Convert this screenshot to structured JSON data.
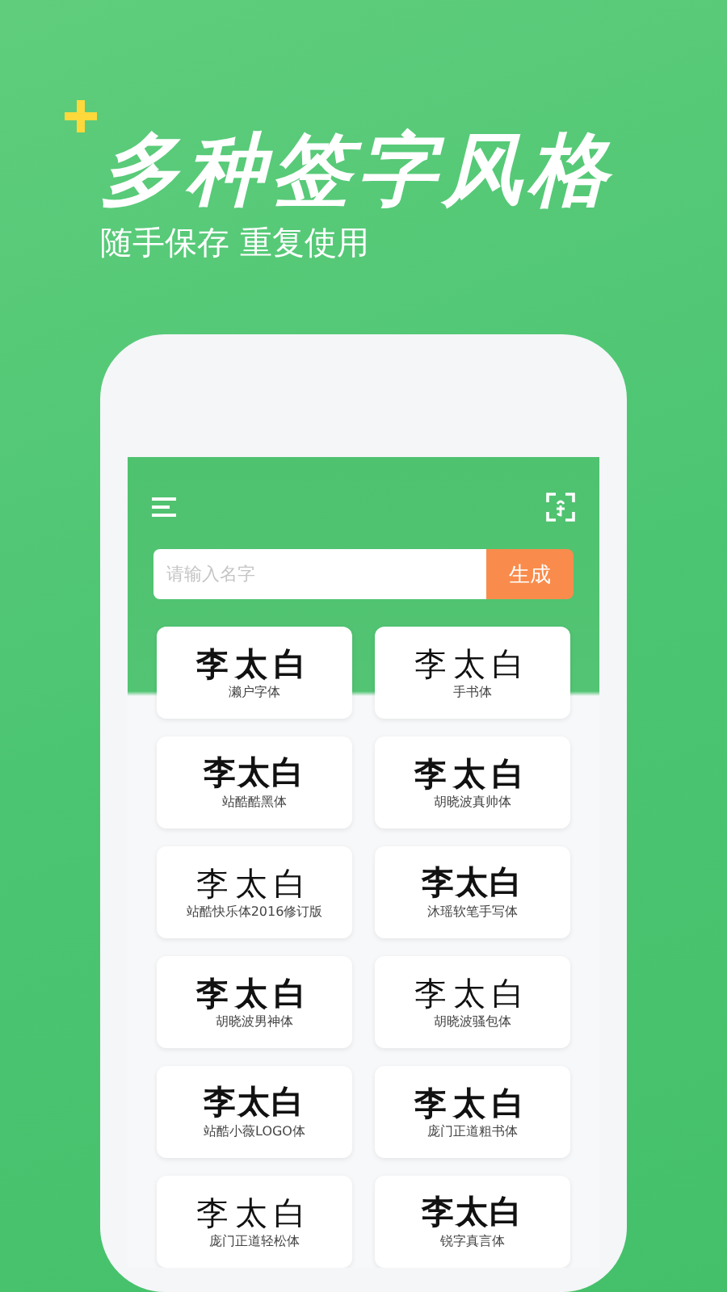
{
  "headline": "多种签字风格",
  "subtitle": "随手保存 重复使用",
  "search": {
    "placeholder": "请输入名字",
    "button": "生成"
  },
  "styles": [
    {
      "sample": "李太白",
      "label": "濑户字体"
    },
    {
      "sample": "李太白",
      "label": "手书体"
    },
    {
      "sample": "李太白",
      "label": "站酷酷黑体"
    },
    {
      "sample": "李太白",
      "label": "胡晓波真帅体"
    },
    {
      "sample": "李太白",
      "label": "站酷快乐体2016修订版"
    },
    {
      "sample": "李太白",
      "label": "沐瑶软笔手写体"
    },
    {
      "sample": "李太白",
      "label": "胡晓波男神体"
    },
    {
      "sample": "李太白",
      "label": "胡晓波骚包体"
    },
    {
      "sample": "李太白",
      "label": "站酷小薇LOGO体"
    },
    {
      "sample": "李太白",
      "label": "庞门正道粗书体"
    },
    {
      "sample": "李太白",
      "label": "庞门正道轻松体"
    },
    {
      "sample": "李太白",
      "label": "锐字真言体"
    }
  ]
}
